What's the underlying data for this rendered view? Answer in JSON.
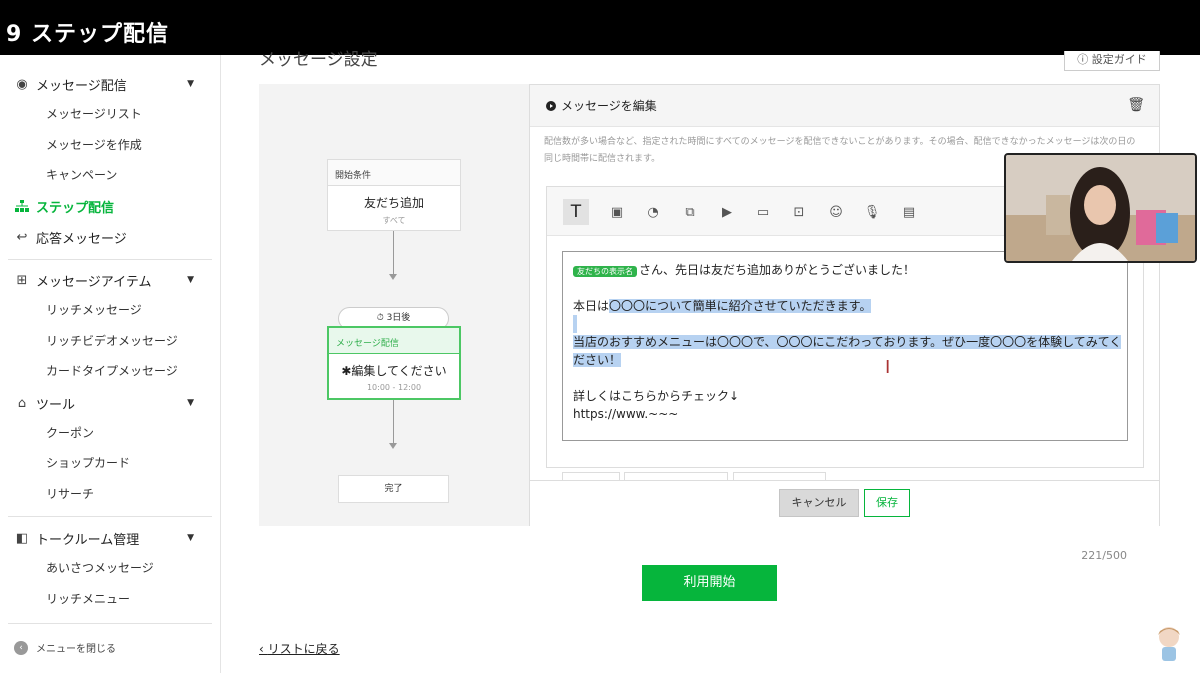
{
  "video_title": "9 ステップ配信",
  "sidebar": {
    "groups": [
      {
        "label": "メッセージ配信",
        "icon": "broadcast-icon",
        "items": [
          "メッセージリスト",
          "メッセージを作成",
          "キャンペーン"
        ]
      },
      {
        "label": "ステップ配信",
        "icon": "step-tree-icon",
        "active": true
      },
      {
        "label": "応答メッセージ",
        "icon": "reply-icon"
      },
      {
        "label": "メッセージアイテム",
        "icon": "message-item-icon",
        "items": [
          "リッチメッセージ",
          "リッチビデオメッセージ",
          "カードタイプメッセージ"
        ]
      },
      {
        "label": "ツール",
        "icon": "store-icon",
        "items": [
          "クーポン",
          "ショップカード",
          "リサーチ"
        ]
      },
      {
        "label": "トークルーム管理",
        "icon": "chatroom-icon",
        "items": [
          "あいさつメッセージ",
          "リッチメニュー"
        ]
      }
    ],
    "close_menu": "メニューを閉じる"
  },
  "main": {
    "section_title": "メッセージ設定",
    "guide_button": "設定ガイド",
    "flow": {
      "start_header": "開始条件",
      "start_main": "友だち追加",
      "start_sub": "すべて",
      "delay": "3日後",
      "msg_header": "メッセージ配信",
      "msg_main": "✱編集してください",
      "msg_time": "10:00 - 12:00",
      "end": "完了"
    },
    "editor": {
      "title": "メッセージを編集",
      "note": "配信数が多い場合など、指定された時間にすべてのメッセージを配信できないことがあります。その場合、配信できなかったメッセージは次の日の同じ時間帯に配信されます。",
      "name_tag": "友だちの表示名",
      "line1": "さん、先日は友だち追加ありがとうございました！",
      "line3_a": "本日は",
      "line3_b": "〇〇〇について簡単に紹介させていただきます。",
      "line5_a": "当店のおすすめメニューは〇〇〇で、〇〇〇にこだわっております。ぜひ一度〇〇〇を体験してみてく",
      "line5_b": "ださい！",
      "line7": "詳しくはこちらからチェック↓",
      "line8": "https://www.~~~",
      "counter": "221/500",
      "cancel": "キャンセル",
      "save": "保存"
    },
    "start_button": "利用開始",
    "back_link": "リストに戻る"
  }
}
